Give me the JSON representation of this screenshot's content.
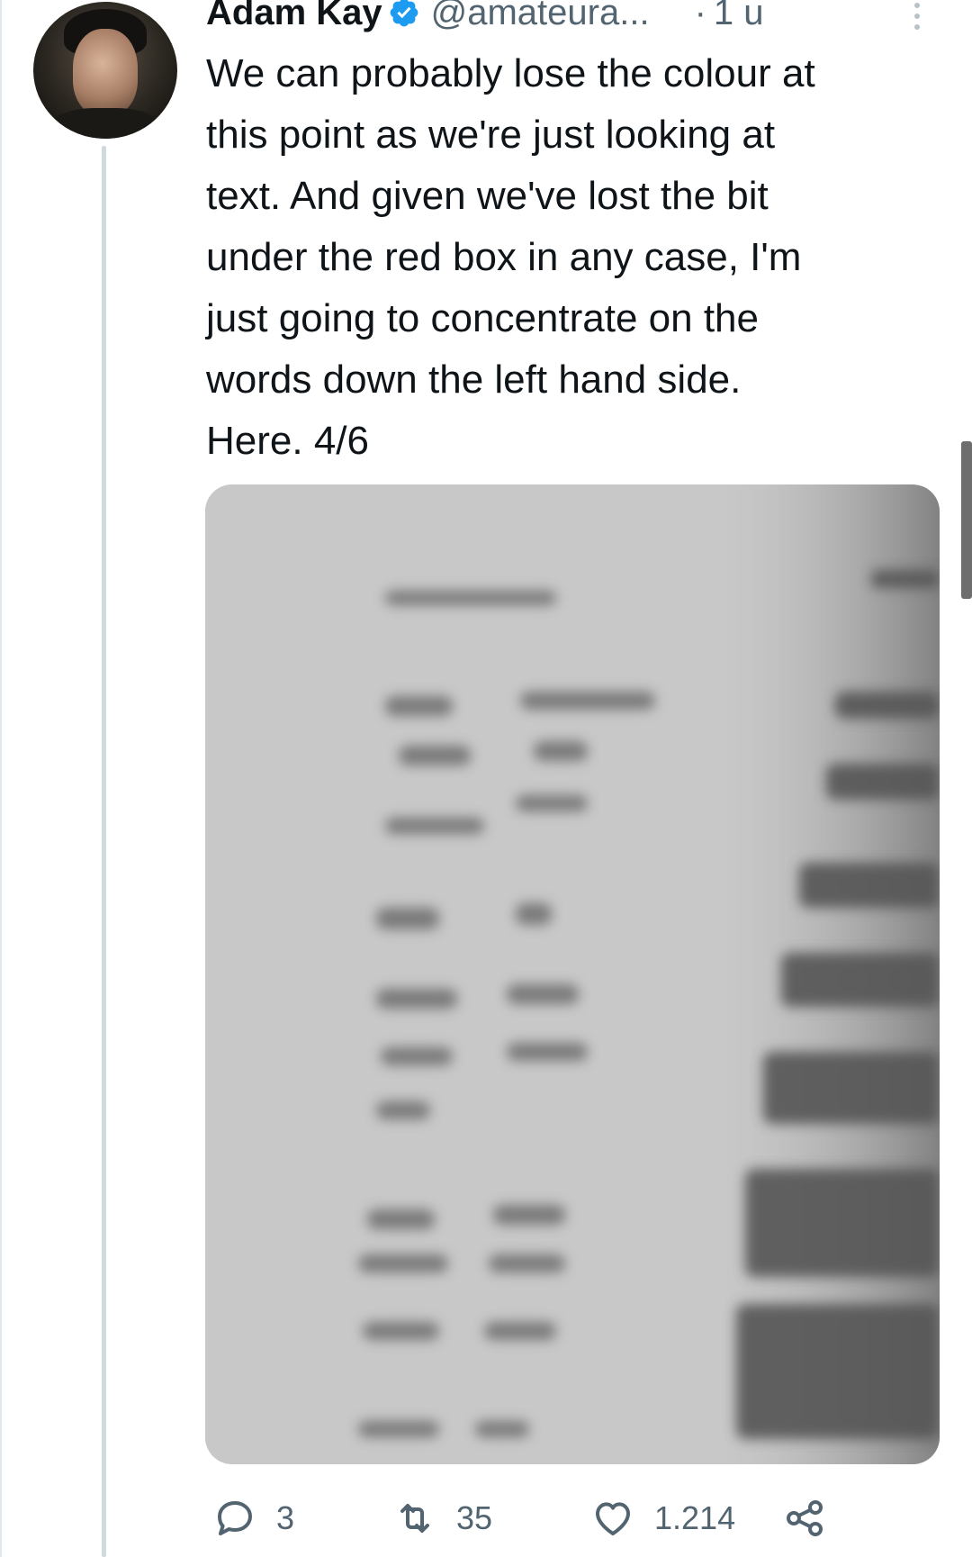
{
  "tweet": {
    "author_name": "Adam Kay",
    "handle": "@amateura...",
    "separator": "·",
    "time": "1 u",
    "text": "We can probably lose the colour at\nthis point as we're just looking at\ntext. And given we've lost the bit\nunder the red box in any case, I'm\njust going to concentrate on the\nwords down the left hand side.\nHere. 4/6",
    "verified": true,
    "verified_color": "#1d9bf0"
  },
  "actions": {
    "reply_count": "3",
    "retweet_count": "35",
    "like_count": "1.214"
  },
  "icons": {
    "more": "more-vertical-icon",
    "reply": "reply-icon",
    "retweet": "retweet-icon",
    "like": "heart-icon",
    "share": "share-icon",
    "verified": "verified-badge-icon"
  },
  "colors": {
    "text": "#0f1419",
    "secondary": "#536471",
    "thread_line": "#cfd9de"
  }
}
